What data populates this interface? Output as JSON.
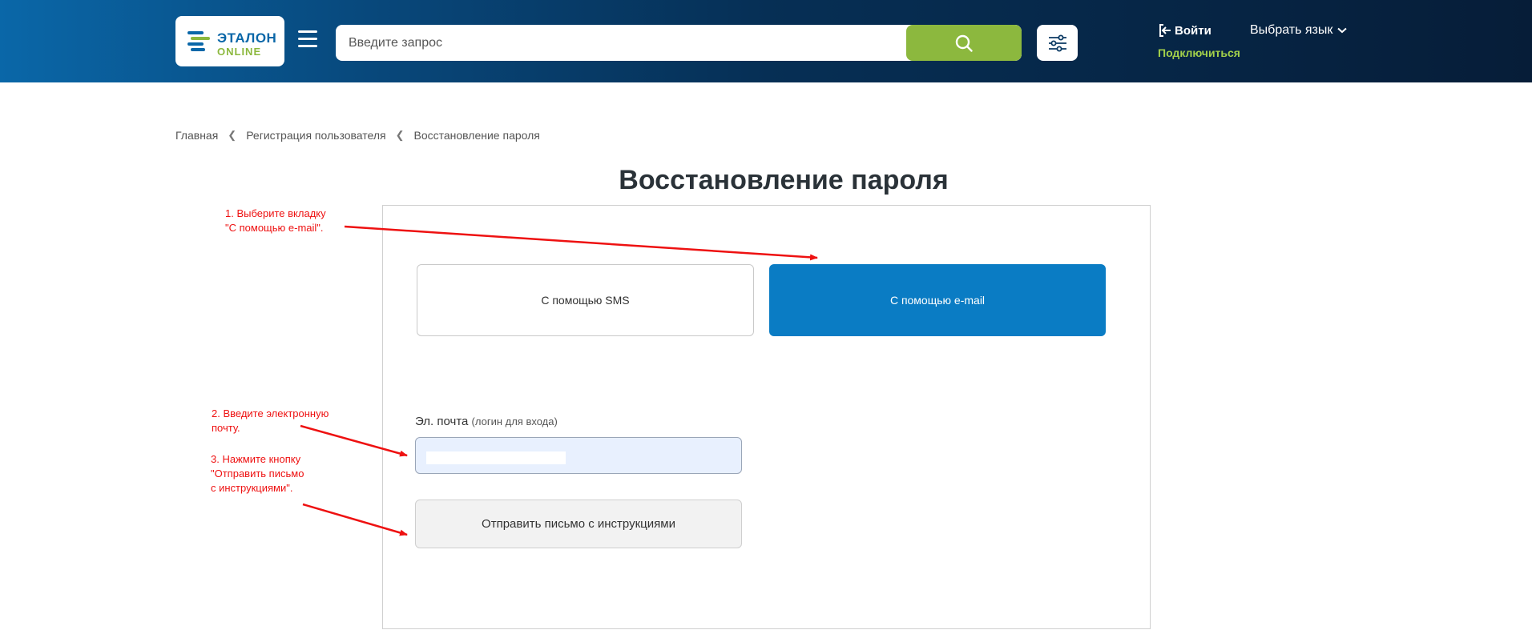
{
  "header": {
    "logo_title": "ЭТАЛОН",
    "logo_sub": "ONLINE",
    "search_placeholder": "Введите запрос",
    "login_label": "Войти",
    "connect_label": "Подключиться",
    "language_label": "Выбрать язык",
    "icons": {
      "logo": "stacked-bars-logo",
      "menu": "hamburger-icon",
      "search": "magnifier-icon",
      "filter": "sliders-icon",
      "login": "login-arrow-icon",
      "language": "chevron-down-icon"
    },
    "colors": {
      "accent_green": "#8cb83e",
      "brand_blue": "#0a67a8",
      "connect": "#a3d14a"
    }
  },
  "breadcrumb": [
    "Главная",
    "Регистрация пользователя",
    "Восстановление пароля"
  ],
  "page_title": "Восстановление пароля",
  "tabs": [
    {
      "label": "С помощью SMS",
      "active": false
    },
    {
      "label": "С помощью e-mail",
      "active": true
    }
  ],
  "form": {
    "email_label": "Эл. почта",
    "email_hint": "(логин для входа)",
    "email_value": "",
    "submit_label": "Отправить письмо с инструкциями"
  },
  "annotations": {
    "color": "#ee1111",
    "step1": "1. Выберите вкладку\n\"С помощью e-mail\".",
    "step2": "2. Введите электронную\nпочту.",
    "step3": "3. Нажмите кнопку\n\"Отправить письмо\nс инструкциями\"."
  }
}
